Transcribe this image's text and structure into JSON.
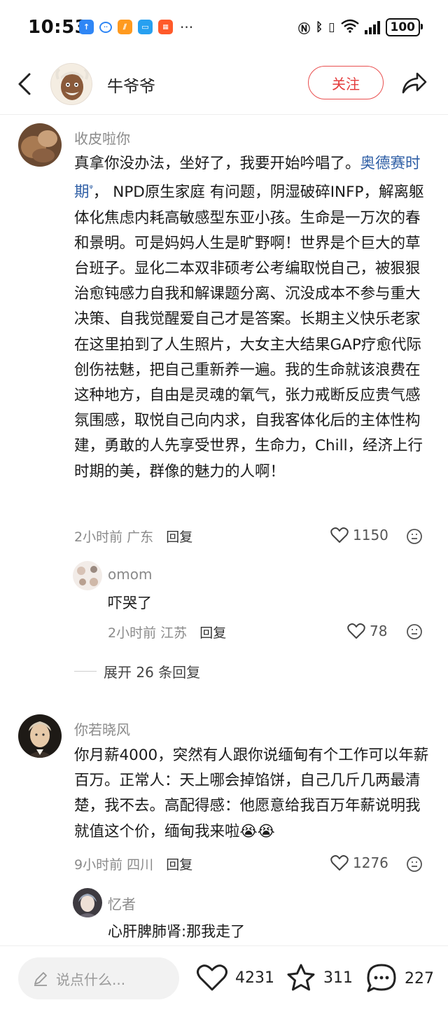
{
  "status_bar": {
    "time": "10:53",
    "apps": [
      {
        "icon": "upload-app-icon",
        "color": "#2f86f5",
        "glyph": "↑"
      },
      {
        "icon": "chat-bubble-icon",
        "color": "#ffffff",
        "glyph": "◌"
      },
      {
        "icon": "orange-app-icon",
        "color": "#ff9a1f",
        "glyph": "⫽"
      },
      {
        "icon": "blue-app-icon",
        "color": "#27a0f0",
        "glyph": "■"
      },
      {
        "icon": "shop-app-icon",
        "color": "#ff5a2a",
        "glyph": "▦"
      }
    ],
    "more": "···",
    "battery": "100"
  },
  "header": {
    "author_name": "牛爷爷",
    "follow_label": "关注"
  },
  "comments": [
    {
      "user": "收皮啦你",
      "text_before_link": "真拿你没办法，坐好了，我要开始吟唱了。",
      "link_text": "奥德赛时期",
      "link_mark": "ᵠ",
      "text_after_link": "， NPD原生家庭 有问题，阴湿破碎INFP，解离躯体化焦虑内耗高敏感型东亚小孩。生命是一万次的春和景明。可是妈妈人生是旷野啊！世界是个巨大的草台班子。显化二本双非硕考公考编取悦自己，被狠狠治愈钝感力自我和解课题分离、沉没成本不参与重大决策、自我觉醒爱自己才是答案。长期主义快乐老家在这里拍到了人生照片，大女主大结果GAP疗愈代际创伤祛魅，把自己重新养一遍。我的生命就该浪费在这种地方，自由是灵魂的氧气，张力戒断反应贵气感氛围感，取悦自己向内求，自我客体化后的主体性构建，勇敢的人先享受世界，生命力，Chill，经济上行时期的美，群像的魅力的人啊！",
      "time": "2小时前",
      "location": "广东",
      "reply_label": "回复",
      "likes": "1150",
      "reply": {
        "user": "omom",
        "text": "吓哭了",
        "time": "2小时前",
        "location": "江苏",
        "reply_label": "回复",
        "likes": "78"
      },
      "expand_label": "展开 26 条回复"
    },
    {
      "user": "你若晓风",
      "text": "你月薪4000，突然有人跟你说缅甸有个工作可以年薪百万。正常人：天上哪会掉馅饼，自己几斤几两最清楚，我不去。高配得感：他愿意给我百万年薪说明我就值这个价，缅甸我来啦",
      "text_emoji": "😭😭",
      "time": "9小时前",
      "location": "四川",
      "reply_label": "回复",
      "likes": "1276",
      "reply": {
        "user": "忆者",
        "text": "心肝脾肺肾:那我走了"
      }
    }
  ],
  "bottom_bar": {
    "input_placeholder": "说点什么...",
    "likes": "4231",
    "favorites": "311",
    "comments": "227"
  }
}
